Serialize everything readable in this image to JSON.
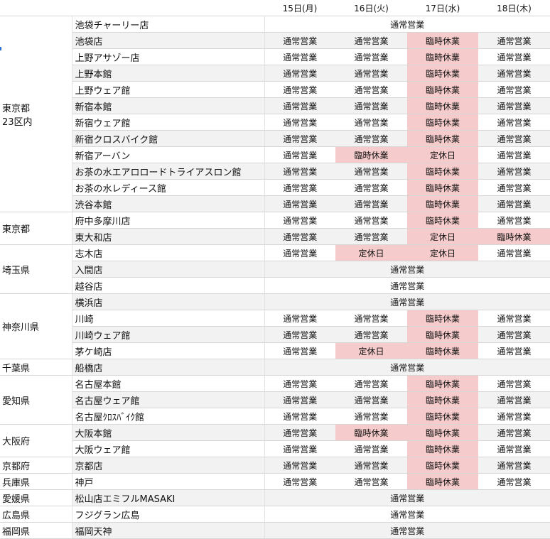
{
  "headers": [
    "15日(月)",
    "16日(火)",
    "17日(水)",
    "18日(木)"
  ],
  "groups": [
    {
      "pref": "東京都\n23区内",
      "rows": [
        {
          "store": "池袋チャーリー店",
          "span": "通常営業"
        },
        {
          "store": "池袋店",
          "cells": [
            "通常営業",
            "通常営業",
            "臨時休業",
            "通常営業"
          ]
        },
        {
          "store": "上野アサゾー店",
          "cells": [
            "通常営業",
            "通常営業",
            "臨時休業",
            "通常営業"
          ]
        },
        {
          "store": "上野本館",
          "cells": [
            "通常営業",
            "通常営業",
            "臨時休業",
            "通常営業"
          ]
        },
        {
          "store": "上野ウェア館",
          "cells": [
            "通常営業",
            "通常営業",
            "臨時休業",
            "通常営業"
          ]
        },
        {
          "store": "新宿本館",
          "cells": [
            "通常営業",
            "通常営業",
            "臨時休業",
            "通常営業"
          ]
        },
        {
          "store": "新宿ウェア館",
          "cells": [
            "通常営業",
            "通常営業",
            "臨時休業",
            "通常営業"
          ]
        },
        {
          "store": "新宿クロスバイク館",
          "cells": [
            "通常営業",
            "通常営業",
            "臨時休業",
            "通常営業"
          ]
        },
        {
          "store": "新宿アーバン",
          "cells": [
            "通常営業",
            "臨時休業",
            "定休日",
            "通常営業"
          ]
        },
        {
          "store": "お茶の水エアロロードトライアスロン館",
          "cells": [
            "通常営業",
            "通常営業",
            "臨時休業",
            "通常営業"
          ]
        },
        {
          "store": "お茶の水レディース館",
          "cells": [
            "通常営業",
            "通常営業",
            "臨時休業",
            "通常営業"
          ]
        },
        {
          "store": "渋谷本館",
          "cells": [
            "通常営業",
            "通常営業",
            "臨時休業",
            "通常営業"
          ]
        }
      ]
    },
    {
      "pref": "東京都",
      "rows": [
        {
          "store": "府中多摩川店",
          "cells": [
            "通常営業",
            "通常営業",
            "臨時休業",
            "通常営業"
          ]
        },
        {
          "store": "東大和店",
          "cells": [
            "通常営業",
            "通常営業",
            "定休日",
            "臨時休業"
          ]
        }
      ]
    },
    {
      "pref": "埼玉県",
      "rows": [
        {
          "store": "志木店",
          "cells": [
            "通常営業",
            "定休日",
            "定休日",
            "通常営業"
          ]
        },
        {
          "store": "入間店",
          "span": "通常営業"
        },
        {
          "store": "越谷店",
          "span": "通常営業"
        }
      ]
    },
    {
      "pref": "神奈川県",
      "rows": [
        {
          "store": "横浜店",
          "span": "通常営業"
        },
        {
          "store": "川崎",
          "cells": [
            "通常営業",
            "通常営業",
            "臨時休業",
            "通常営業"
          ]
        },
        {
          "store": "川崎ウェア館",
          "cells": [
            "通常営業",
            "通常営業",
            "臨時休業",
            "通常営業"
          ]
        },
        {
          "store": "茅ケ崎店",
          "cells": [
            "通常営業",
            "定休日",
            "臨時休業",
            "通常営業"
          ]
        }
      ]
    },
    {
      "pref": "千葉県",
      "rows": [
        {
          "store": "船橋店",
          "span": "通常営業"
        }
      ]
    },
    {
      "pref": "愛知県",
      "rows": [
        {
          "store": "名古屋本館",
          "cells": [
            "通常営業",
            "通常営業",
            "臨時休業",
            "通常営業"
          ]
        },
        {
          "store": "名古屋ウェア館",
          "cells": [
            "通常営業",
            "通常営業",
            "臨時休業",
            "通常営業"
          ]
        },
        {
          "store": "名古屋ｸﾛｽﾊﾞｲｸ館",
          "cells": [
            "通常営業",
            "通常営業",
            "臨時休業",
            "通常営業"
          ]
        }
      ]
    },
    {
      "pref": "大阪府",
      "rows": [
        {
          "store": "大阪本館",
          "cells": [
            "通常営業",
            "臨時休業",
            "臨時休業",
            "通常営業"
          ]
        },
        {
          "store": "大阪ウェア館",
          "cells": [
            "通常営業",
            "通常営業",
            "臨時休業",
            "通常営業"
          ]
        }
      ]
    },
    {
      "pref": "京都府",
      "rows": [
        {
          "store": "京都店",
          "cells": [
            "通常営業",
            "通常営業",
            "臨時休業",
            "通常営業"
          ]
        }
      ]
    },
    {
      "pref": "兵庫県",
      "rows": [
        {
          "store": "神戸",
          "cells": [
            "通常営業",
            "通常営業",
            "臨時休業",
            "通常営業"
          ]
        }
      ]
    },
    {
      "pref": "愛媛県",
      "rows": [
        {
          "store": "松山店エミフルMASAKI",
          "span": "通常営業"
        }
      ]
    },
    {
      "pref": "広島県",
      "rows": [
        {
          "store": "フジグラン広島",
          "span": "通常営業"
        }
      ]
    },
    {
      "pref": "福岡県",
      "rows": [
        {
          "store": "福岡天神",
          "span": "通常営業"
        }
      ]
    }
  ],
  "colors": {
    "closed": "#f6cbcb",
    "alt_row": "#f2f2f2",
    "marker": "#2a6fd0"
  }
}
